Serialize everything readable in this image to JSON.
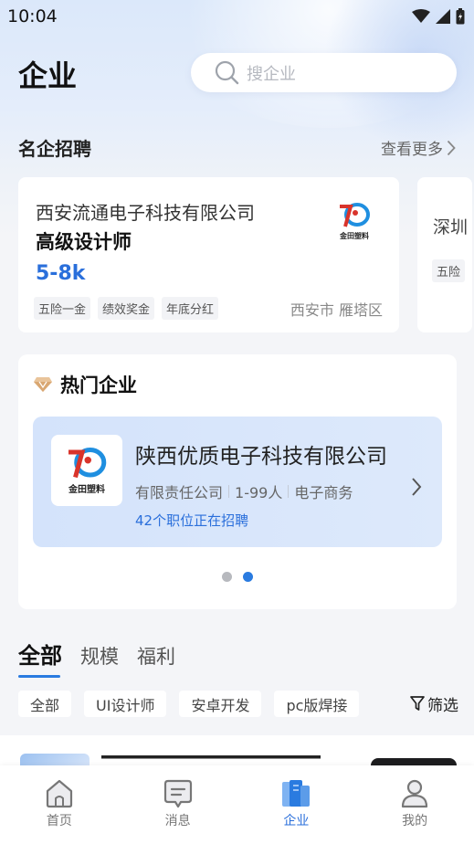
{
  "status_bar": {
    "time": "10:04"
  },
  "header": {
    "title": "企业",
    "search_placeholder": "搜企业"
  },
  "famous": {
    "title": "名企招聘",
    "more": "查看更多",
    "cards": [
      {
        "company": "西安流通电子科技有限公司",
        "job": "高级设计师",
        "salary": "5-8k",
        "tags": [
          "五险一金",
          "绩效奖金",
          "年底分红"
        ],
        "location": "西安市 雁塔区",
        "logo_text": "金田塑料"
      },
      {
        "company": "深圳",
        "tags": [
          "五险"
        ]
      }
    ]
  },
  "hot": {
    "title": "热门企业",
    "company": {
      "name": "陕西优质电子科技有限公司",
      "type": "有限责任公司",
      "size": "1-99人",
      "industry": "电子商务",
      "jobs": "42个职位正在招聘",
      "logo_text": "金田塑料"
    },
    "dots": 2,
    "active_dot": 1
  },
  "tabs": [
    {
      "label": "全部",
      "active": true
    },
    {
      "label": "规模",
      "active": false
    },
    {
      "label": "福利",
      "active": false
    }
  ],
  "filters": {
    "chips": [
      "全部",
      "UI设计师",
      "安卓开发",
      "pc版焊接"
    ],
    "filter_label": "筛选"
  },
  "tabbar": [
    {
      "label": "首页",
      "icon": "home-icon",
      "active": false
    },
    {
      "label": "消息",
      "icon": "message-icon",
      "active": false
    },
    {
      "label": "企业",
      "icon": "enterprise-icon",
      "active": true
    },
    {
      "label": "我的",
      "icon": "profile-icon",
      "active": false
    }
  ],
  "colors": {
    "accent": "#2a7be0",
    "salary": "#2a6fdb"
  }
}
